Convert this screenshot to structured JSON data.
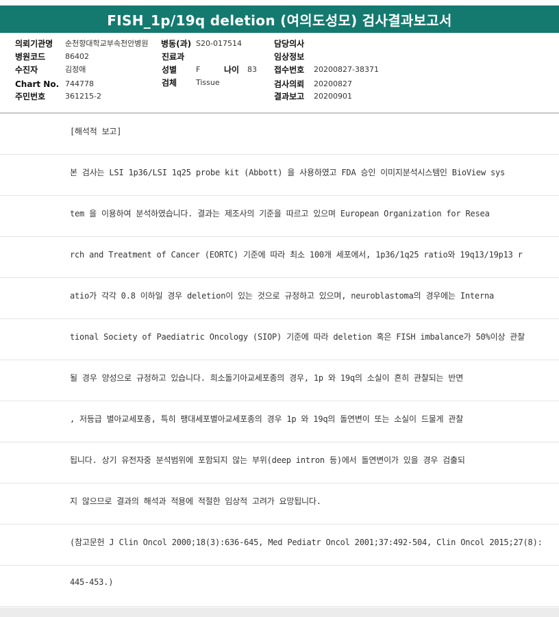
{
  "title": "FISH_1p/19q deletion (여의도성모) 검사결과보고서",
  "info": {
    "institution_label": "의뢰기관명",
    "institution_value": "순천향대학교부속천안병원",
    "ward_label": "병동(과)",
    "ward_value": "S20-017514",
    "doctor_label": "담당의사",
    "doctor_value": "",
    "hospital_code_label": "병원코드",
    "hospital_code_value": "86402",
    "department_label": "진료과",
    "department_value": "",
    "clinical_info_label": "임상정보",
    "clinical_info_value": "",
    "patient_label": "수진자",
    "patient_value": "김정애",
    "sex_label": "성별",
    "sex_value": "F",
    "age_label": "나이",
    "age_value": "83",
    "receipt_no_label": "접수번호",
    "receipt_no_value": "20200827-38371",
    "chart_label": "Chart No.",
    "chart_value": "744778",
    "specimen_label": "검체",
    "specimen_value": "Tissue",
    "request_label": "검사의뢰",
    "request_value": "20200827",
    "resident_no_label": "주민번호",
    "resident_no_value": "361215-2",
    "result_report_label": "결과보고",
    "result_report_value": "20200901"
  },
  "report_lines": [
    "[해석적 보고]",
    "본 검사는 LSI 1p36/LSI 1q25 probe kit (Abbott) 을 사용하였고 FDA 승인 이미지분석시스템인 BioView sys",
    "tem 을 이용하여 분석하였습니다. 결과는 제조사의 기준을 따르고 있으며 European Organization for Resea",
    "rch and Treatment of Cancer (EORTC) 기준에 따라 최소 100개 세포에서, 1p36/1q25 ratio와 19q13/19p13 r",
    "atio가 각각 0.8 이하일 경우 deletion이 있는 것으로 규정하고 있으며, neuroblastoma의 경우에는 Interna",
    "tional Society of Paediatric Oncology (SIOP) 기준에 따라 deletion 혹은 FISH imbalance가 50%이상 관찰",
    "될 경우 양성으로 규정하고 있습니다. 희소돌기아교세포종의 경우, 1p 와 19q의 소실이 흔히 관찰되는 반면",
    ", 저등급 별아교세포종, 특히 팽대세포별아교세포종의 경우 1p 와 19q의 돌연변이 또는 소실이 드물게 관찰",
    "됩니다. 상기 유전자중 분석범위에 포함되지 않는 부위(deep intron 등)에서 돌연변이가 있을 경우 검출되",
    "지 않으므로 결과의 해석과 적용에 적절한 임상적 고려가 요망됩니다.",
    "(참고문헌 J Clin Oncol 2000;18(3):636-645, Med Pediatr Oncol 2001;37:492-504, Clin Oncol 2015;27(8):",
    "445-453.)"
  ]
}
